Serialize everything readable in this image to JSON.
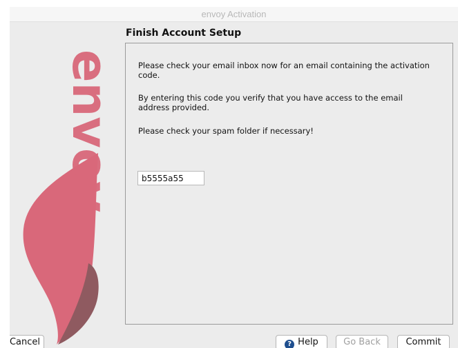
{
  "window": {
    "title": "envoy Activation"
  },
  "logo": {
    "text": "envoy",
    "colors": {
      "primary": "#d9687a",
      "secondary": "#8f5a60"
    }
  },
  "content": {
    "heading": "Finish Account Setup",
    "messages": [
      "Please check your email inbox now for an email containing the activation code.",
      "By entering this code you verify that you have access to the email address provided.",
      "Please check your spam folder if necessary!"
    ],
    "activation_code": "b5555a55"
  },
  "buttons": {
    "cancel": "Cancel",
    "help": "Help",
    "go_back": "Go Back",
    "commit": "Commit"
  },
  "icons": {
    "help": "question-circle-icon"
  }
}
